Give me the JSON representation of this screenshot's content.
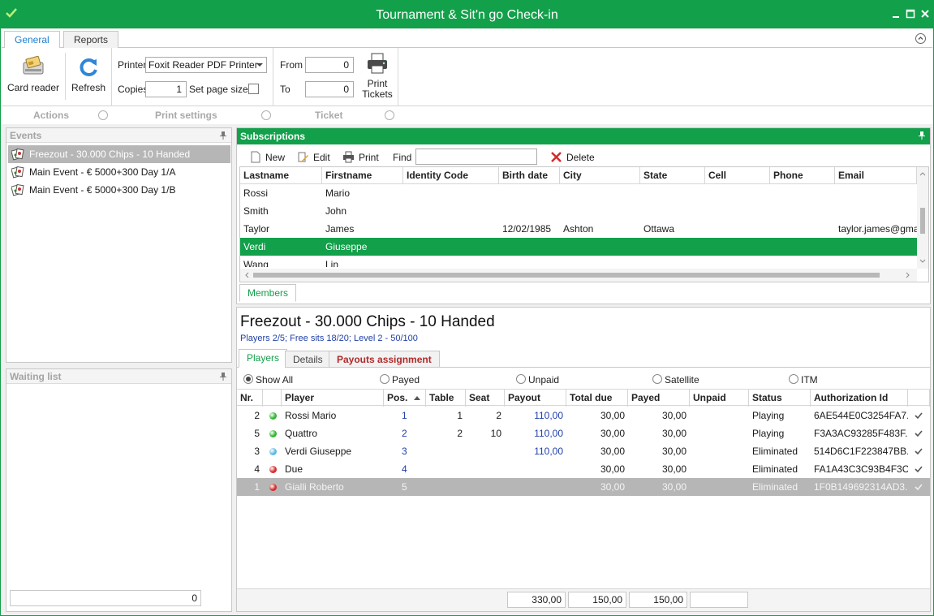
{
  "window": {
    "title": "Tournament & Sit'n go Check-in",
    "accent": "#12a04a"
  },
  "ribbon": {
    "tabs": [
      {
        "label": "General",
        "active": true
      },
      {
        "label": "Reports",
        "active": false
      }
    ],
    "actions": {
      "card_reader": "Card reader",
      "refresh": "Refresh",
      "group_label": "Actions"
    },
    "print_settings": {
      "printer_label": "Printer",
      "printer_value": "Foxit Reader PDF Printer",
      "copies_label": "Copies",
      "copies_value": "1",
      "set_page_size_label": "Set page size",
      "set_page_size_checked": false,
      "group_label": "Print settings"
    },
    "ticket": {
      "from_label": "From",
      "from_value": "0",
      "to_label": "To",
      "to_value": "0",
      "print_tickets_line1": "Print",
      "print_tickets_line2": "Tickets",
      "group_label": "Ticket"
    }
  },
  "events_panel": {
    "title": "Events",
    "items": [
      {
        "label": "Freezout - 30.000 Chips - 10 Handed",
        "selected": true
      },
      {
        "label": "Main Event - € 5000+300 Day 1/A",
        "selected": false
      },
      {
        "label": "Main Event - € 5000+300 Day 1/B",
        "selected": false
      }
    ]
  },
  "waiting_list": {
    "title": "Waiting list",
    "count": "0"
  },
  "subscriptions": {
    "title": "Subscriptions",
    "toolbar": {
      "new": "New",
      "edit": "Edit",
      "print": "Print",
      "find_label": "Find",
      "find_value": "",
      "delete": "Delete"
    },
    "columns": [
      "Lastname",
      "Firstname",
      "Identity Code",
      "Birth date",
      "City",
      "State",
      "Cell",
      "Phone",
      "Email"
    ],
    "rows": [
      {
        "cells": [
          "Rossi",
          "Mario",
          "",
          "",
          "",
          "",
          "",
          "",
          ""
        ],
        "selected": false
      },
      {
        "cells": [
          "Smith",
          "John",
          "",
          "",
          "",
          "",
          "",
          "",
          ""
        ],
        "selected": false
      },
      {
        "cells": [
          "Taylor",
          "James",
          "",
          "12/02/1985",
          "Ashton",
          "Ottawa",
          "",
          "",
          "taylor.james@gmail"
        ],
        "selected": false
      },
      {
        "cells": [
          "Verdi",
          "Giuseppe",
          "",
          "",
          "",
          "",
          "",
          "",
          ""
        ],
        "selected": true
      },
      {
        "cells": [
          "Wang",
          "Lin",
          "",
          "",
          "",
          "",
          "",
          "",
          ""
        ],
        "selected": false
      }
    ],
    "bottom_tab": "Members"
  },
  "detail": {
    "title": "Freezout - 30.000 Chips - 10 Handed",
    "subtitle": "Players 2/5; Free sits 18/20; Level 2 - 50/100",
    "tabs": [
      {
        "label": "Players",
        "active": true
      },
      {
        "label": "Details",
        "active": false
      },
      {
        "label": "Payouts assignment",
        "active": false
      }
    ],
    "filters": [
      {
        "label": "Show All",
        "checked": true
      },
      {
        "label": "Payed",
        "checked": false
      },
      {
        "label": "Unpaid",
        "checked": false
      },
      {
        "label": "Satellite",
        "checked": false
      },
      {
        "label": "ITM",
        "checked": false
      }
    ],
    "columns": [
      "Nr.",
      "Player",
      "Pos.",
      "Table",
      "Seat",
      "Payout",
      "Total due",
      "Payed",
      "Unpaid",
      "Status",
      "Authorization Id"
    ],
    "rows": [
      {
        "nr": "2",
        "dot": "#2fb52f",
        "player": "Rossi Mario",
        "pos": "1",
        "table": "1",
        "seat": "2",
        "payout": "110,00",
        "total_due": "30,00",
        "payed": "30,00",
        "unpaid": "",
        "status": "Playing",
        "auth": "6AE544E0C3254FA7...",
        "selected": false
      },
      {
        "nr": "5",
        "dot": "#2fb52f",
        "player": "Quattro",
        "pos": "2",
        "table": "2",
        "seat": "10",
        "payout": "110,00",
        "total_due": "30,00",
        "payed": "30,00",
        "unpaid": "",
        "status": "Playing",
        "auth": "F3A3AC93285F483F...",
        "selected": false
      },
      {
        "nr": "3",
        "dot": "#5ab8e8",
        "player": "Verdi Giuseppe",
        "pos": "3",
        "table": "",
        "seat": "",
        "payout": "110,00",
        "total_due": "30,00",
        "payed": "30,00",
        "unpaid": "",
        "status": "Eliminated",
        "auth": "514D6C1F223847BB...",
        "selected": false
      },
      {
        "nr": "4",
        "dot": "#d62a2a",
        "player": "Due",
        "pos": "4",
        "table": "",
        "seat": "",
        "payout": "",
        "total_due": "30,00",
        "payed": "30,00",
        "unpaid": "",
        "status": "Eliminated",
        "auth": "FA1A43C3C93B4F3C...",
        "selected": false
      },
      {
        "nr": "1",
        "dot": "#d62a2a",
        "player": "Gialli Roberto",
        "pos": "5",
        "table": "",
        "seat": "",
        "payout": "",
        "total_due": "30,00",
        "payed": "30,00",
        "unpaid": "",
        "status": "Eliminated",
        "auth": "1F0B149692314AD3...",
        "selected": true
      }
    ],
    "totals": {
      "payout": "330,00",
      "total_due": "150,00",
      "payed": "150,00",
      "unpaid": ""
    }
  }
}
